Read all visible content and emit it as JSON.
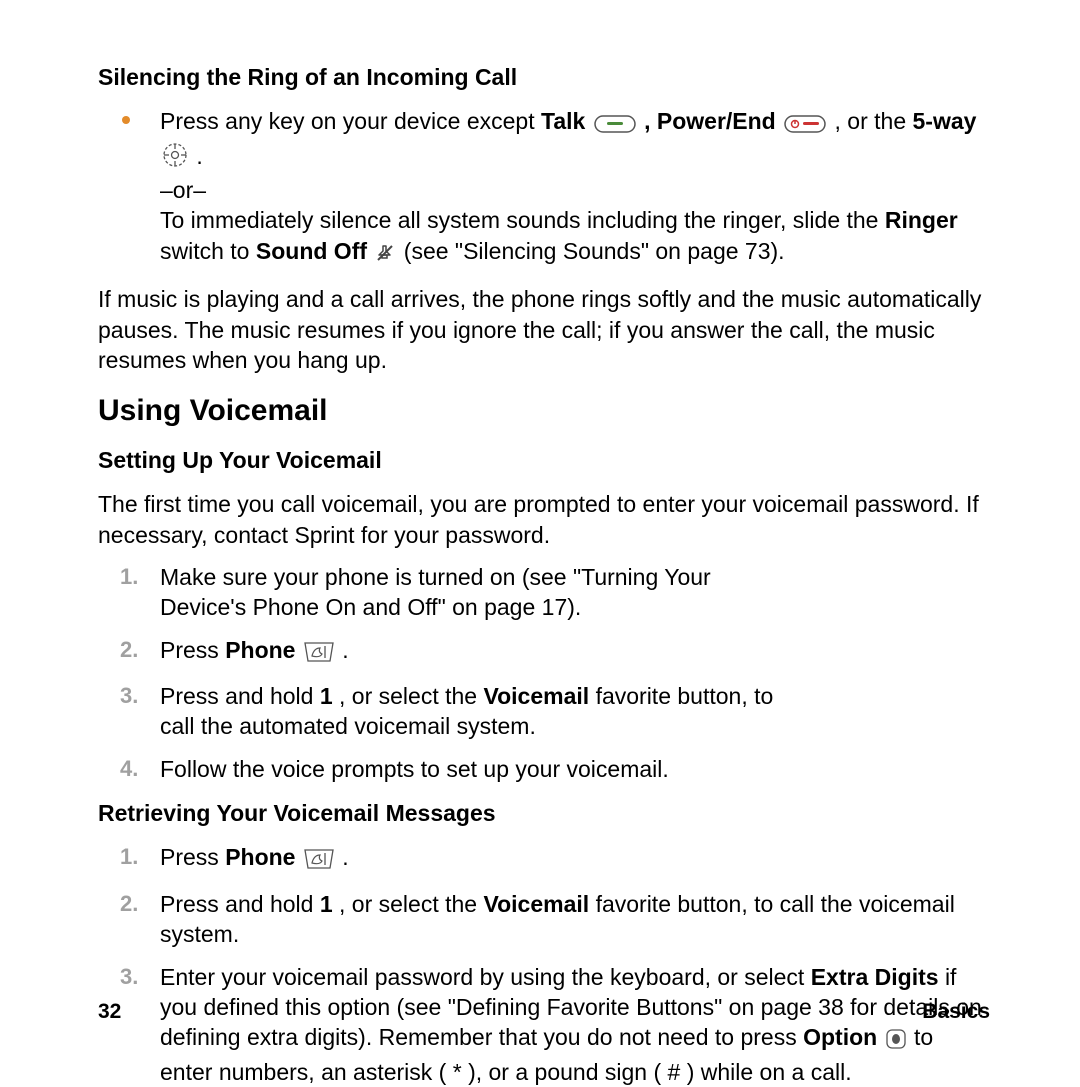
{
  "section1": {
    "heading": "Silencing the Ring of an Incoming Call",
    "bullet_prefix": "Press any key on your device except ",
    "talk": "Talk",
    "sep1": ", ",
    "powerend": "Power/End",
    "sep2": ", or the ",
    "fiveway": "5-way",
    "period": ".",
    "or_line": "–or–",
    "line2a": "To immediately silence all system sounds including the ringer, slide the ",
    "ringer": "Ringer",
    "line2b": " switch to ",
    "soundoff": "Sound Off",
    "line2c": " (see \"Silencing Sounds\" on page 73).",
    "para": "If music is playing and a call arrives, the phone rings softly and the music automatically pauses. The music resumes if you ignore the call; if you answer the call, the music resumes when you hang up."
  },
  "section2": {
    "h2": "Using Voicemail",
    "sub1": "Setting Up Your Voicemail",
    "intro": "The first time you call voicemail, you are prompted to enter your voicemail password. If necessary, contact Sprint for your password.",
    "steps1": {
      "s1": "Make sure your phone is turned on (see \"Turning Your Device's Phone On and Off\" on page 17).",
      "s2a": "Press ",
      "s2b": "Phone",
      "s2c": ".",
      "s3a": "Press and hold ",
      "s3b": "1",
      "s3c": ", or select the ",
      "s3d": "Voicemail",
      "s3e": " favorite button, to call the automated voicemail system.",
      "s4": "Follow the voice prompts to set up your voicemail."
    },
    "sub2": "Retrieving Your Voicemail Messages",
    "steps2": {
      "s1a": "Press ",
      "s1b": "Phone",
      "s1c": ".",
      "s2a": "Press and hold ",
      "s2b": "1",
      "s2c": ", or select the ",
      "s2d": "Voicemail",
      "s2e": " favorite button, to call the voicemail system.",
      "s3a": "Enter your voicemail password by using the keyboard, or select ",
      "s3b": "Extra Digits",
      "s3c": " if you defined this option (see \"Defining Favorite Buttons\" on page 38 for details on defining extra digits). Remember that you do not need to press ",
      "s3d": "Option",
      "s3e": " to enter numbers, an asterisk ( * ), or a pound sign ( # ) while on a call."
    }
  },
  "footer": {
    "page": "32",
    "section": "Basics"
  }
}
